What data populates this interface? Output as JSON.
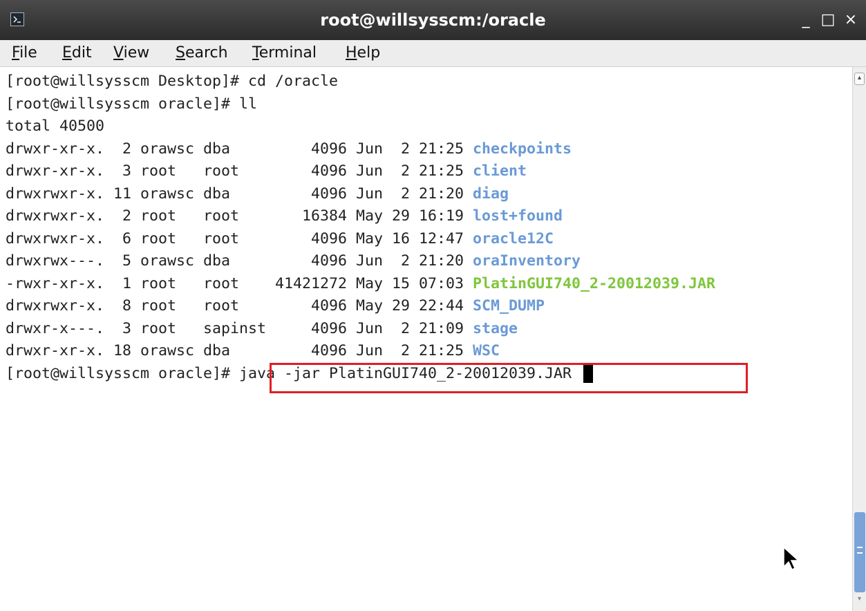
{
  "window": {
    "title": "root@willsysscm:/oracle",
    "controls": {
      "minimize": "_",
      "maximize": "□",
      "close": "×"
    }
  },
  "menu": [
    "File",
    "Edit",
    "View",
    "Search",
    "Terminal",
    "Help"
  ],
  "terminal": {
    "lines": [
      {
        "text": "[root@willsysscm Desktop]# cd /oracle"
      },
      {
        "text": "[root@willsysscm oracle]# ll"
      },
      {
        "text": "total 40500"
      },
      {
        "prefix": "drwxr-xr-x.  2 orawsc dba         4096 Jun  2 21:25 ",
        "name": "checkpoints",
        "type": "dir"
      },
      {
        "prefix": "drwxr-xr-x.  3 root   root        4096 Jun  2 21:25 ",
        "name": "client",
        "type": "dir"
      },
      {
        "prefix": "drwxrwxr-x. 11 orawsc dba         4096 Jun  2 21:20 ",
        "name": "diag",
        "type": "dir"
      },
      {
        "prefix": "drwxrwxr-x.  2 root   root       16384 May 29 16:19 ",
        "name": "lost+found",
        "type": "dir"
      },
      {
        "prefix": "drwxrwxr-x.  6 root   root        4096 May 16 12:47 ",
        "name": "oracle12C",
        "type": "dir"
      },
      {
        "prefix": "drwxrwx---.  5 orawsc dba         4096 Jun  2 21:20 ",
        "name": "oraInventory",
        "type": "dir"
      },
      {
        "prefix": "-rwxr-xr-x.  1 root   root    41421272 May 15 07:03 ",
        "name": "PlatinGUI740_2-20012039.JAR",
        "type": "exe"
      },
      {
        "prefix": "drwxrwxr-x.  8 root   root        4096 May 29 22:44 ",
        "name": "SCM_DUMP",
        "type": "dir"
      },
      {
        "prefix": "drwxr-x---.  3 root   sapinst     4096 Jun  2 21:09 ",
        "name": "stage",
        "type": "dir"
      },
      {
        "prefix": "drwxr-xr-x. 18 orawsc dba         4096 Jun  2 21:25 ",
        "name": "WSC",
        "type": "dir"
      }
    ],
    "prompt": "[root@willsysscm oracle]# ",
    "current_command": "java -jar PlatinGUI740_2-20012039.JAR "
  },
  "colors": {
    "directory": "#6a9ad6",
    "executable": "#7ec63b",
    "highlight_box": "#e01e25",
    "titlebar": "#3a3a3a"
  },
  "icons": [
    "terminal-app-icon",
    "mouse-pointer-icon"
  ]
}
